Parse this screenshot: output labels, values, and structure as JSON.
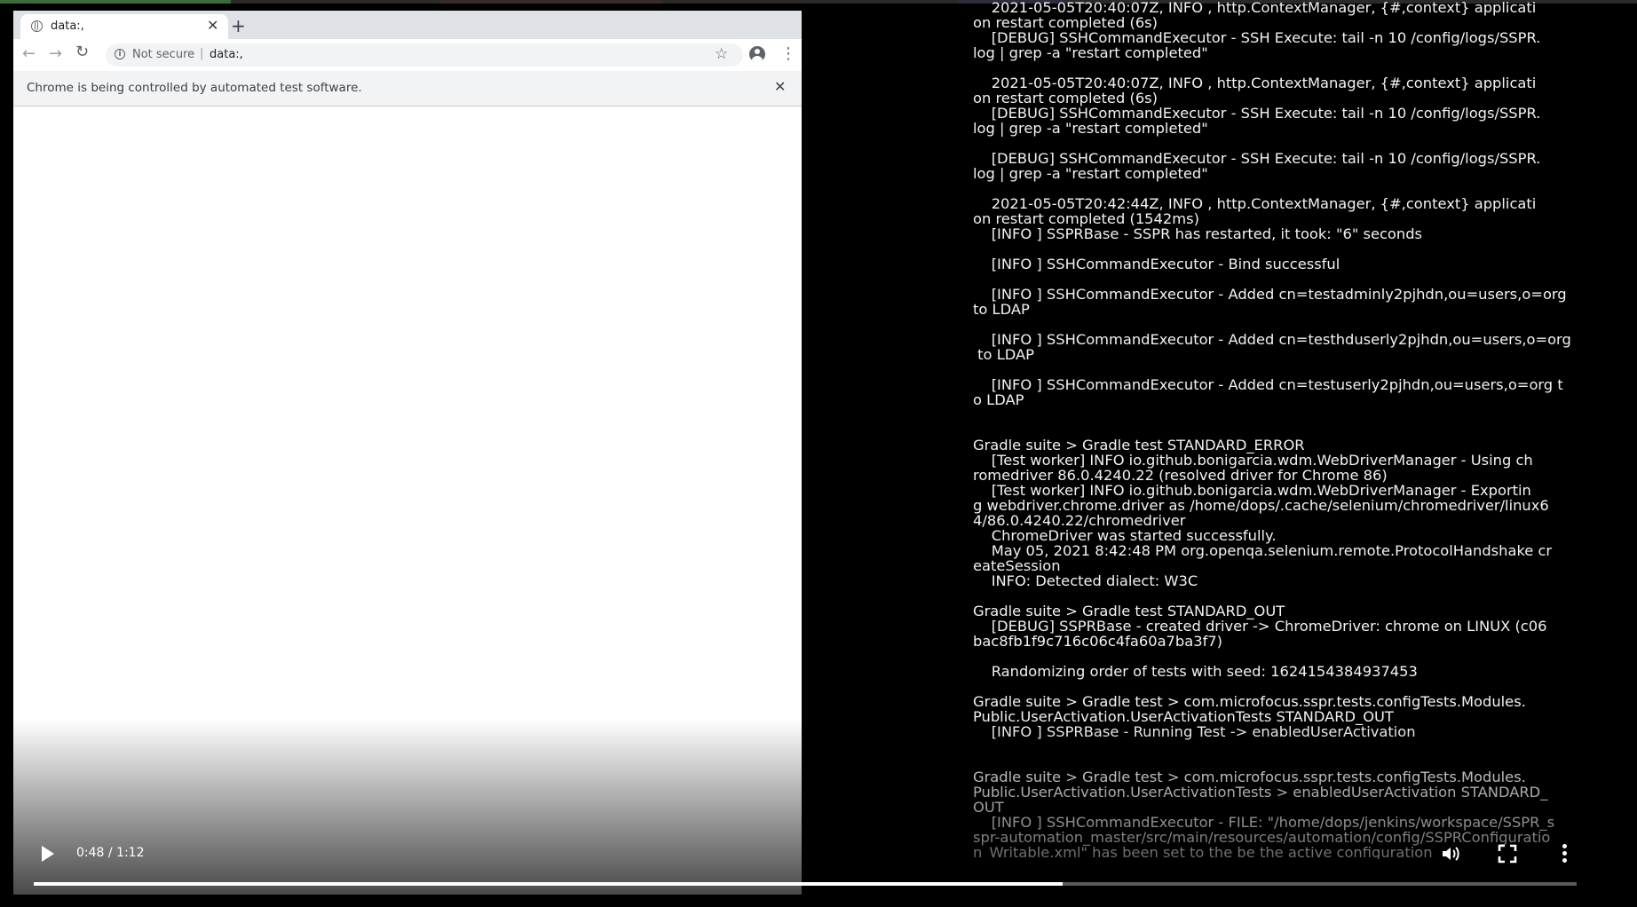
{
  "browser": {
    "tab_title": "data:,",
    "security_label": "Not secure",
    "separator": "|",
    "url": "data:,",
    "infobar_message": "Chrome is being controlled by automated test software.",
    "icons": [
      "globe-icon",
      "close-icon",
      "plus-icon",
      "back-arrow-icon",
      "forward-arrow-icon",
      "reload-icon",
      "info-icon",
      "star-icon",
      "account-icon",
      "kebab-menu-icon"
    ]
  },
  "terminal": {
    "lines": [
      "    2021-05-05T20:40:07Z, INFO , http.ContextManager, {#,context} applicati",
      "on restart completed (6s)",
      "    [DEBUG] SSHCommandExecutor - SSH Execute: tail -n 10 /config/logs/SSPR.",
      "log | grep -a \"restart completed\"",
      "",
      "    2021-05-05T20:40:07Z, INFO , http.ContextManager, {#,context} applicati",
      "on restart completed (6s)",
      "    [DEBUG] SSHCommandExecutor - SSH Execute: tail -n 10 /config/logs/SSPR.",
      "log | grep -a \"restart completed\"",
      "",
      "    [DEBUG] SSHCommandExecutor - SSH Execute: tail -n 10 /config/logs/SSPR.",
      "log | grep -a \"restart completed\"",
      "",
      "    2021-05-05T20:42:44Z, INFO , http.ContextManager, {#,context} applicati",
      "on restart completed (1542ms)",
      "    [INFO ] SSPRBase - SSPR has restarted, it took: \"6\" seconds",
      "",
      "    [INFO ] SSHCommandExecutor - Bind successful",
      "",
      "    [INFO ] SSHCommandExecutor - Added cn=testadminly2pjhdn,ou=users,o=org",
      "to LDAP",
      "",
      "    [INFO ] SSHCommandExecutor - Added cn=testhduserly2pjhdn,ou=users,o=org",
      " to LDAP",
      "",
      "    [INFO ] SSHCommandExecutor - Added cn=testuserly2pjhdn,ou=users,o=org t",
      "o LDAP",
      "",
      "",
      "Gradle suite > Gradle test STANDARD_ERROR",
      "    [Test worker] INFO io.github.bonigarcia.wdm.WebDriverManager - Using ch",
      "romedriver 86.0.4240.22 (resolved driver for Chrome 86)",
      "    [Test worker] INFO io.github.bonigarcia.wdm.WebDriverManager - Exportin",
      "g webdriver.chrome.driver as /home/dops/.cache/selenium/chromedriver/linux6",
      "4/86.0.4240.22/chromedriver",
      "    ChromeDriver was started successfully.",
      "    May 05, 2021 8:42:48 PM org.openqa.selenium.remote.ProtocolHandshake cr",
      "eateSession",
      "    INFO: Detected dialect: W3C",
      "",
      "Gradle suite > Gradle test STANDARD_OUT",
      "    [DEBUG] SSPRBase - created driver -> ChromeDriver: chrome on LINUX (c06",
      "bac8fb1f9c716c06c4fa60a7ba3f7)",
      "",
      "    Randomizing order of tests with seed: 1624154384937453",
      "",
      "Gradle suite > Gradle test > com.microfocus.sspr.tests.configTests.Modules.",
      "Public.UserActivation.UserActivationTests STANDARD_OUT",
      "    [INFO ] SSPRBase - Running Test -> enabledUserActivation",
      "",
      "",
      "Gradle suite > Gradle test > com.microfocus.sspr.tests.configTests.Modules.",
      "Public.UserActivation.UserActivationTests > enabledUserActivation STANDARD_",
      "OUT",
      "    [INFO ] SSHCommandExecutor - FILE: \"/home/dops/jenkins/workspace/SSPR_s",
      "spr-automation_master/src/main/resources/automation/config/SSPRConfiguratio",
      "n_Writable.xml\" has been set to the be the active configuration"
    ]
  },
  "video": {
    "time_display": "0:48 / 1:12",
    "progress_fraction": 0.667,
    "icons": [
      "play-icon",
      "volume-icon",
      "fullscreen-icon",
      "more-options-icon"
    ]
  }
}
